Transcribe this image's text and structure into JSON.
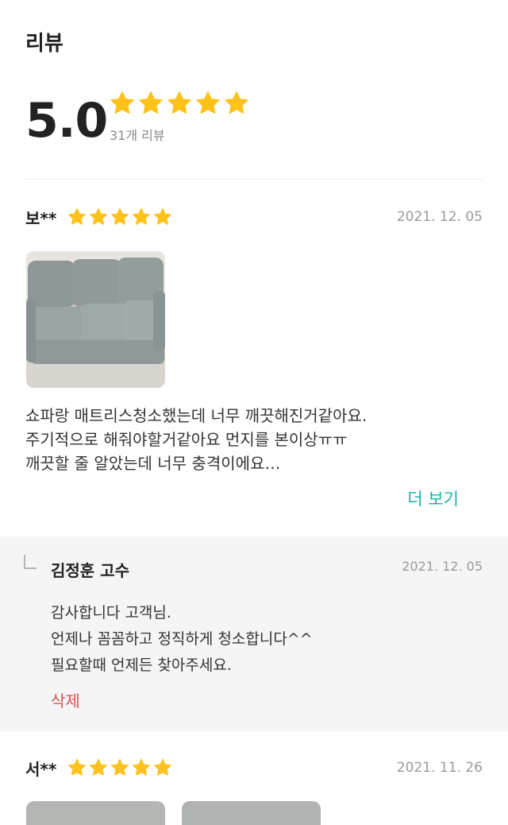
{
  "header": {
    "title": "리뷰"
  },
  "summary": {
    "score": "5.0",
    "rating": 5,
    "count_text": "31개 리뷰"
  },
  "colors": {
    "star": "#ffc21a",
    "accent": "#17b3a8",
    "delete": "#d9534f"
  },
  "reviews": [
    {
      "name": "보**",
      "rating": 5,
      "date": "2021. 12. 05",
      "text_lines": [
        "쇼파랑 매트리스청소했는데 너무 깨끗해진거같아요.",
        "주기적으로 해줘야할거같아요 먼지를 본이상ㅠㅠ",
        "깨끗할 줄 알았는데 너무 충격이에요…"
      ],
      "more_label": "더 보기",
      "reply": {
        "name": "김정훈 고수",
        "date": "2021. 12. 05",
        "text_lines": [
          "감사합니다 고객님.",
          "언제나 꼼꼼하고 정직하게 청소합니다^^",
          "필요할때 언제든 찾아주세요."
        ],
        "delete_label": "삭제"
      }
    },
    {
      "name": "서**",
      "rating": 5,
      "date": "2021. 11. 26"
    }
  ]
}
